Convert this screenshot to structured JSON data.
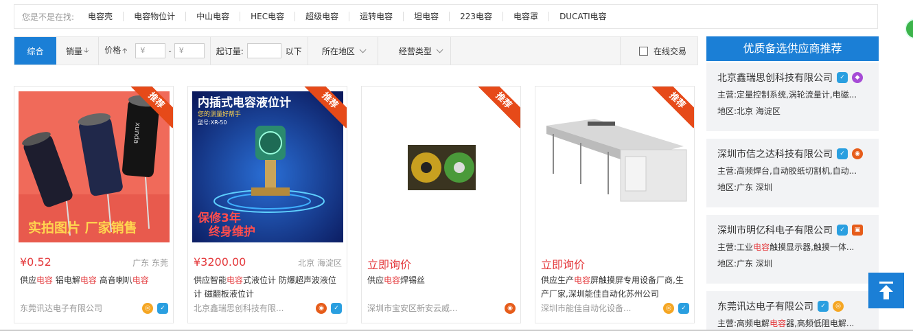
{
  "suggest": {
    "lead": "您是不是在找:",
    "keywords": [
      "电容壳",
      "电容物位计",
      "中山电容",
      "HEC电容",
      "超级电容",
      "运转电容",
      "坦电容",
      "223电容",
      "电容罩",
      "DUCATI电容"
    ]
  },
  "filter": {
    "tab_all": "综合",
    "tab_sales": "销量",
    "tab_price": "价格",
    "price_min_placeholder": "¥",
    "price_sep": "-",
    "price_max_placeholder": "¥",
    "moq_label": "起订量:",
    "moq_suffix": "以下",
    "region_label": "所在地区",
    "biz_type_label": "经营类型",
    "online_trade_label": "在线交易"
  },
  "products": [
    {
      "ribbon": "推荐",
      "price": "¥0.52",
      "location": "广东 东莞",
      "desc_parts": [
        "供应",
        "电容",
        " 铝电解",
        "电容",
        " 高音喇叭",
        "电容"
      ],
      "seller": "东莞讯达电子有限公司",
      "img_text_1": "实拍图片  厂家销售",
      "img_text_2": "xunda"
    },
    {
      "ribbon": "推荐",
      "price": "¥3200.00",
      "location": "北京 海淀区",
      "desc_parts": [
        "供应智能",
        "电容",
        "式液位计 防爆超声波液位计 磁翻板液位计"
      ],
      "seller": "北京鑫瑞思创科技有限...",
      "img_text_1": "内插式电容液位计",
      "img_text_2": "您的测量好帮手",
      "img_text_3": "型号:XR-50",
      "img_text_4": "保修3年",
      "img_text_5": "终身维护"
    },
    {
      "ribbon": "推荐",
      "price": "立即询价",
      "location": "",
      "desc_parts": [
        "供应",
        "电容",
        "焊锡丝"
      ],
      "seller": "深圳市宝安区新安云威..."
    },
    {
      "ribbon": "推荐",
      "price": "立即询价",
      "location": "",
      "desc_parts": [
        "供应生产",
        "电容",
        "屏触摸屏专用设备厂商,生产厂家,深圳能佳自动化苏州公司"
      ],
      "seller": "深圳市能佳自动化设备..."
    }
  ],
  "sidebar": {
    "title": "优质备选供应商推荐",
    "suppliers": [
      {
        "name": "北京鑫瑞思创科技有限公司",
        "main_label": "主营:",
        "main": "定量控制系统,涡轮流量计,电磁...",
        "region_label": "地区:",
        "region": "北京 海淀区"
      },
      {
        "name": "深圳市佶之达科技有限公司",
        "main_label": "主营:",
        "main": "高频焊台,自动胶纸切割机,自动...",
        "region_label": "地区:",
        "region": "广东 深圳"
      },
      {
        "name": "深圳市明亿科电子有限公司",
        "main_label": "主营:",
        "main_parts": [
          "工业",
          "电容",
          "触摸显示器,触摸一体..."
        ],
        "region_label": "地区:",
        "region": "广东 深圳"
      },
      {
        "name": "东莞讯达电子有限公司",
        "main_label": "主营:",
        "main_parts": [
          "高频电解",
          "电容",
          "器,高频低阻电解..."
        ]
      }
    ]
  },
  "colors": {
    "accent": "#1b7fd6",
    "price_red": "#e4393c",
    "ribbon": "#e64a19"
  }
}
